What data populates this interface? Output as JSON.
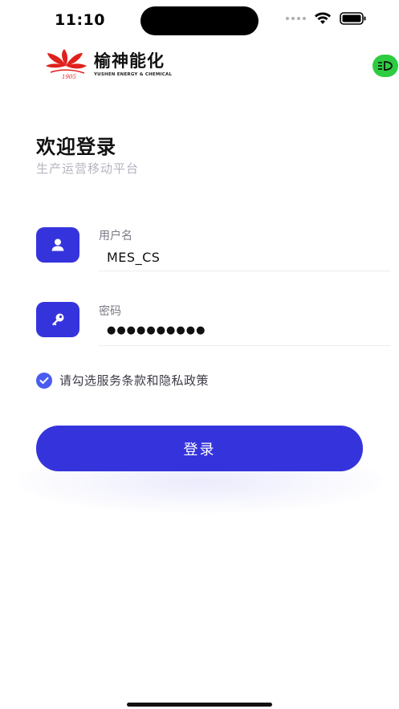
{
  "status_bar": {
    "time": "11:10"
  },
  "brand": {
    "name_cn": "榆神能化",
    "name_en": "YUSHEN ENERGY & CHEMICAL",
    "year_mark": "1905",
    "logo_color": "#e0201b"
  },
  "welcome": {
    "title": "欢迎登录",
    "subtitle": "生产运营移动平台"
  },
  "username": {
    "label": "用户名",
    "value": "MES_CS",
    "icon": "user-icon"
  },
  "password": {
    "label": "密码",
    "value": "●●●●●●●●●●",
    "icon": "key-icon"
  },
  "agreement": {
    "text": "请勾选服务条款和隐私政策",
    "checked": true
  },
  "login": {
    "label": "登录"
  },
  "colors": {
    "primary": "#3534dc",
    "badge": "#2ecc40",
    "subtitle": "#b5b5c0"
  }
}
